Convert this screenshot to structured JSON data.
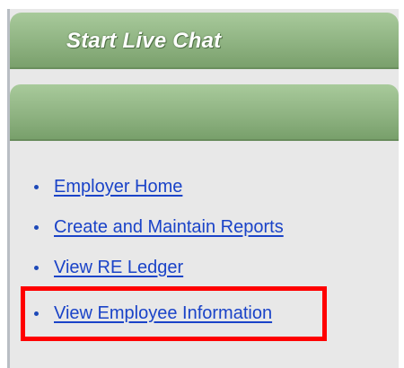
{
  "chat": {
    "title": "Start Live Chat"
  },
  "menu": {
    "items": [
      {
        "label": "Employer Home"
      },
      {
        "label": "Create and Maintain Reports"
      },
      {
        "label": "View RE Ledger"
      },
      {
        "label": "View Employee Information"
      }
    ]
  },
  "highlight": {
    "target": "View Employee Information",
    "color": "#ff0000"
  },
  "colors": {
    "link": "#1a43c8",
    "header_green": "#8fb382",
    "panel_background": "#e8e8e8"
  }
}
